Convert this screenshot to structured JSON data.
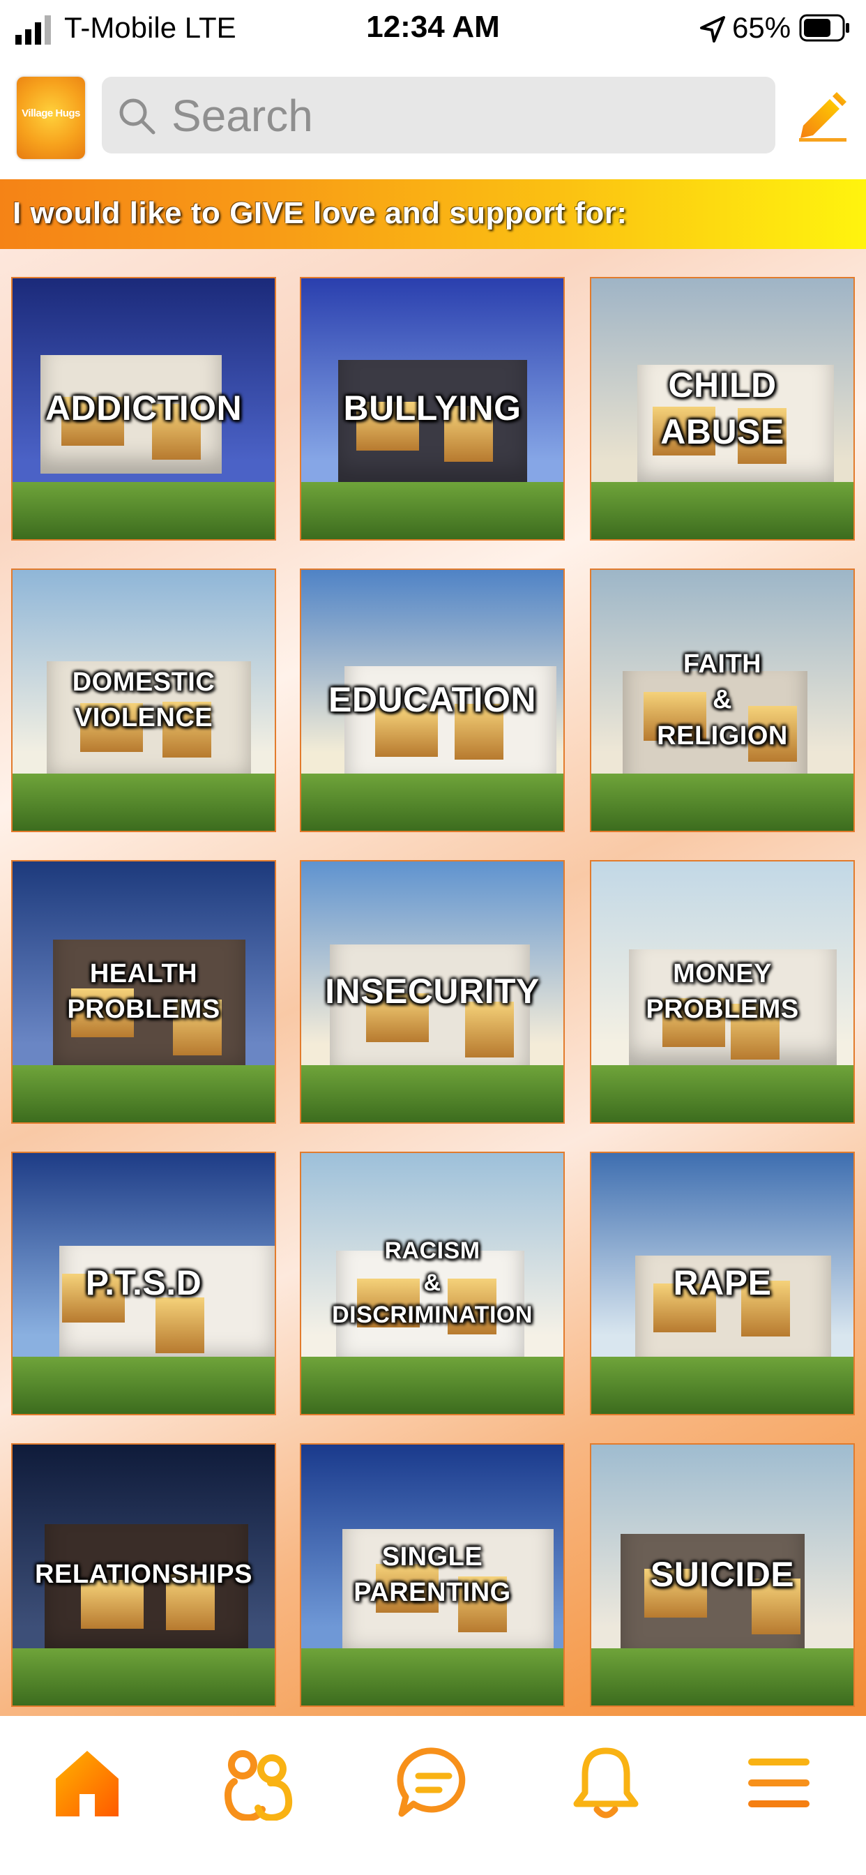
{
  "status_bar": {
    "carrier": "T-Mobile  LTE",
    "time": "12:34 AM",
    "battery": "65%"
  },
  "header": {
    "logo_text": "Village Hugs",
    "search_placeholder": "Search"
  },
  "banner": {
    "text": "I would like to GIVE love and support for:"
  },
  "categories": [
    {
      "label": "ADDICTION"
    },
    {
      "label": "BULLYING"
    },
    {
      "label": "CHILD\nABUSE"
    },
    {
      "label": "DOMESTIC\nVIOLENCE"
    },
    {
      "label": "EDUCATION"
    },
    {
      "label": "FAITH\n&\nRELIGION"
    },
    {
      "label": "HEALTH\nPROBLEMS"
    },
    {
      "label": "INSECURITY"
    },
    {
      "label": "MONEY\nPROBLEMS"
    },
    {
      "label": "P.T.S.D"
    },
    {
      "label": "RACISM\n&\nDISCRIMINATION"
    },
    {
      "label": "RAPE"
    },
    {
      "label": "RELATIONSHIPS"
    },
    {
      "label": "SINGLE\nPARENTING"
    },
    {
      "label": "SUICIDE"
    }
  ],
  "nav": {
    "items": [
      "home-icon",
      "people-icon",
      "chat-icon",
      "bell-icon",
      "menu-icon"
    ]
  },
  "colors": {
    "accent_orange": "#f58316",
    "accent_yellow": "#fff40e",
    "tile_border": "#e27b2c"
  }
}
